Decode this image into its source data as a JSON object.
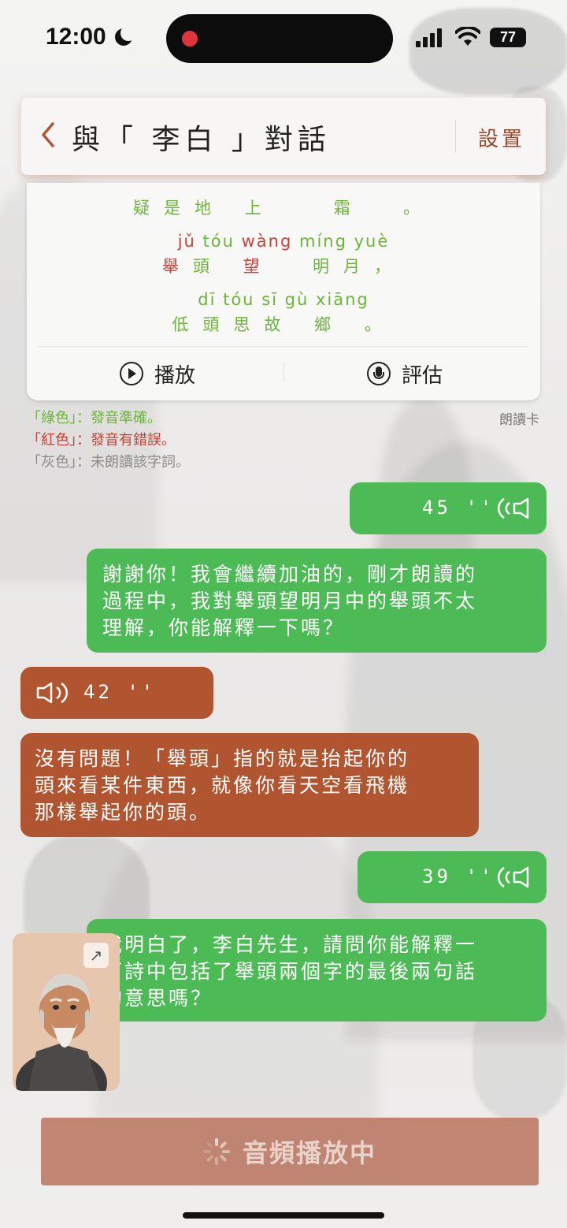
{
  "status_bar": {
    "time": "12:00",
    "battery": "77"
  },
  "header": {
    "title": "與「 李白 」對話",
    "settings_label": "設置"
  },
  "poem_card": {
    "tail_line": {
      "hanzi": [
        "疑",
        "是",
        "地",
        "上",
        "霜",
        "。"
      ]
    },
    "line3": {
      "pinyin": [
        "jǔ",
        "tóu",
        "wàng",
        "míng",
        "yuè"
      ],
      "hanzi": [
        "舉",
        "頭",
        "望",
        "明",
        "月",
        "，"
      ]
    },
    "line4": {
      "pinyin": [
        "dī",
        "tóu",
        "sī",
        "gù",
        "xiāng"
      ],
      "hanzi": [
        "低",
        "頭",
        "思",
        "故",
        "鄉",
        "。"
      ]
    },
    "play_label": "播放",
    "evaluate_label": "評估",
    "tag": "朗讀卡"
  },
  "legend": {
    "green_key": "「綠色」",
    "green_desc": "：發音準確。",
    "red_key": "「紅色」",
    "red_desc": "：發音有錯誤。",
    "gray_key": "「灰色」",
    "gray_desc": "：未朗讀該字詞。"
  },
  "messages": [
    {
      "role": "user",
      "type": "voice",
      "duration": "45 ''"
    },
    {
      "role": "user",
      "type": "text",
      "lines": [
        "謝謝你！我會繼續加油的，剛才朗讀的",
        "過程中，我對舉頭望明月中的舉頭不太",
        "理解，你能解釋一下嗎？"
      ]
    },
    {
      "role": "bot",
      "type": "voice",
      "duration": "42 ''"
    },
    {
      "role": "bot",
      "type": "text",
      "lines": [
        "沒有問題！「舉頭」指的就是抬起你的",
        "頭來看某件東西，就像你看天空看飛機",
        "那樣舉起你的頭。"
      ]
    },
    {
      "role": "user",
      "type": "voice",
      "duration": "39 ''"
    },
    {
      "role": "user",
      "type": "text",
      "lines": [
        "我明白了，李白先生，請問你能解釋一",
        "下詩中包括了舉頭兩個字的最後兩句話",
        "的意思嗎？"
      ]
    }
  ],
  "bottom_button": {
    "label": "音頻播放中"
  },
  "colors": {
    "user_bubble": "#4cba55",
    "bot_bubble": "#b15530",
    "accent": "#b1553a",
    "correct": "#6cb43b",
    "error": "#c8423a"
  },
  "icons": {
    "back": "chevron-left-icon",
    "play": "play-circle-icon",
    "evaluate": "microphone-circle-icon",
    "voice_user": "sound-wave-right-icon",
    "voice_bot": "speaker-icon",
    "expand": "expand-arrow-icon",
    "loading": "spinner-icon"
  }
}
